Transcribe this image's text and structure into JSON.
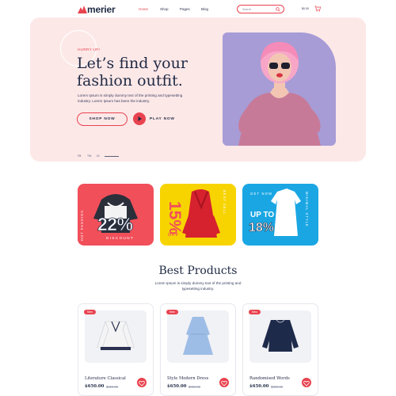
{
  "brand": {
    "name": "merier",
    "accent": "#e8434f",
    "dark": "#1f2a44"
  },
  "nav": {
    "home": "Home",
    "shop": "Shop",
    "pages": "Pages",
    "blog": "Blog"
  },
  "search": {
    "placeholder": "Search"
  },
  "cart": {
    "label": "$0.00"
  },
  "hero": {
    "kicker": "HURRY UP!",
    "title_line1": "Let’s find your",
    "title_line2": "fashion outfit.",
    "desc_line1": "Lorem Ipsum is simply dummy text of the printing and typesetting",
    "desc_line2": "industry. Lorem Ipsum has been the industry.",
    "shop_now": "SHOP NOW",
    "play_now": "PLAY NOW",
    "social": [
      "FB",
      "TW",
      "IG"
    ]
  },
  "promos": [
    {
      "vertical": "HOT FASHION",
      "big": "22%",
      "sub": "DISCOUNT",
      "color": "#f14f5a"
    },
    {
      "vertical": "BEST SELL",
      "big": "15%",
      "sub": "OFF",
      "color": "#f7d400"
    },
    {
      "top": "GET NOW",
      "vertical": "MINIMAL STYLE",
      "line1": "UP TO",
      "big": "18%",
      "color": "#1aa6e3"
    }
  ],
  "best": {
    "title": "Best Products",
    "desc_line1": "Lorem Ipsum is simply dummy text of the printing and",
    "desc_line2": "typesetting industry."
  },
  "products": [
    {
      "badge": "New",
      "name": "Literature Classical",
      "price": "$650.00",
      "old": "$850.00"
    },
    {
      "badge": "New",
      "name": "Style Modern Dress",
      "price": "$650.00",
      "old": "$850.00"
    },
    {
      "badge": "New",
      "name": "Randomised Words",
      "price": "$650.00",
      "old": "$850.00"
    }
  ]
}
